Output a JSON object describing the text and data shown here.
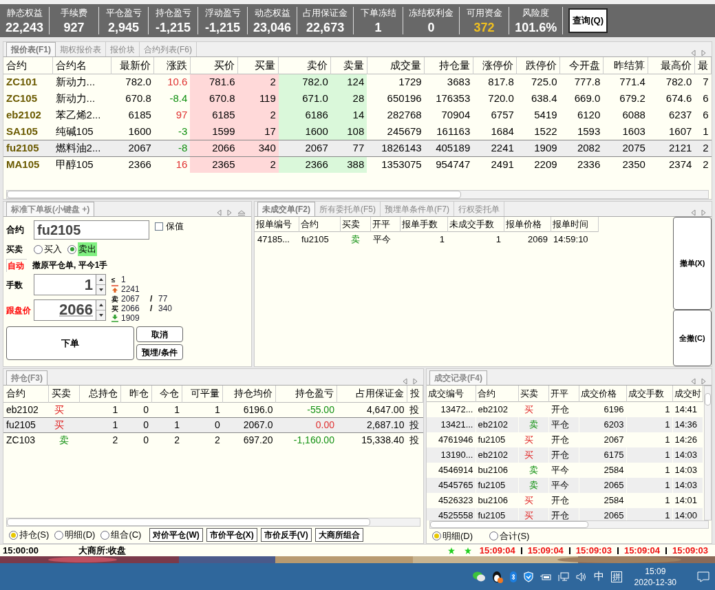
{
  "stats": [
    {
      "label": "静态权益",
      "value": "22,243",
      "highlight": false
    },
    {
      "label": "手续费",
      "value": "927",
      "highlight": false
    },
    {
      "label": "平仓盈亏",
      "value": "2,945",
      "highlight": false
    },
    {
      "label": "持仓盈亏",
      "value": "-1,215",
      "highlight": false
    },
    {
      "label": "浮动盈亏",
      "value": "-1,215",
      "highlight": false
    },
    {
      "label": "动态权益",
      "value": "23,046",
      "highlight": false
    },
    {
      "label": "占用保证金",
      "value": "22,673",
      "highlight": false
    },
    {
      "label": "下单冻结",
      "value": "1",
      "highlight": false
    },
    {
      "label": "冻结权利金",
      "value": "0",
      "highlight": false
    },
    {
      "label": "可用资金",
      "value": "372",
      "highlight": true
    },
    {
      "label": "风险度",
      "value": "101.6%",
      "highlight": false
    }
  ],
  "query_button": "查询(Q)",
  "quote_panel": {
    "tabs": [
      {
        "label": "报价表(F1)",
        "selected": true
      },
      {
        "label": "期权报价表",
        "selected": false
      },
      {
        "label": "报价块",
        "selected": false
      },
      {
        "label": "合约列表(F6)",
        "selected": false
      }
    ],
    "columns": [
      "合约",
      "合约名",
      "最新价",
      "涨跌",
      "买价",
      "买量",
      "卖价",
      "卖量",
      "成交量",
      "持仓量",
      "涨停价",
      "跌停价",
      "今开盘",
      "昨结算",
      "最高价",
      "最"
    ],
    "rows": [
      {
        "cells": [
          "ZC101",
          "新动力...",
          "782.0",
          "10.6",
          "781.6",
          "2",
          "782.0",
          "124",
          "1729",
          "3683",
          "817.8",
          "725.0",
          "777.8",
          "771.4",
          "782.0",
          "7"
        ],
        "rising": true,
        "selected": false
      },
      {
        "cells": [
          "ZC105",
          "新动力...",
          "670.8",
          "-8.4",
          "670.8",
          "119",
          "671.0",
          "28",
          "650196",
          "176353",
          "720.0",
          "638.4",
          "669.0",
          "679.2",
          "674.6",
          "6"
        ],
        "rising": false,
        "selected": false
      },
      {
        "cells": [
          "eb2102",
          "苯乙烯2...",
          "6185",
          "97",
          "6185",
          "2",
          "6186",
          "14",
          "282768",
          "70904",
          "6757",
          "5419",
          "6120",
          "6088",
          "6237",
          "6"
        ],
        "rising": true,
        "selected": false
      },
      {
        "cells": [
          "SA105",
          "纯碱105",
          "1600",
          "-3",
          "1599",
          "17",
          "1600",
          "108",
          "245679",
          "161163",
          "1684",
          "1522",
          "1593",
          "1603",
          "1607",
          "1"
        ],
        "rising": false,
        "selected": false
      },
      {
        "cells": [
          "fu2105",
          "燃料油2...",
          "2067",
          "-8",
          "2066",
          "340",
          "2067",
          "77",
          "1826143",
          "405189",
          "2241",
          "1909",
          "2082",
          "2075",
          "2121",
          "2"
        ],
        "rising": false,
        "selected": true
      },
      {
        "cells": [
          "MA105",
          "甲醇105",
          "2366",
          "16",
          "2365",
          "2",
          "2366",
          "388",
          "1353075",
          "954747",
          "2491",
          "2209",
          "2336",
          "2350",
          "2374",
          "2"
        ],
        "rising": true,
        "selected": false
      }
    ]
  },
  "order_panel": {
    "tab": "标准下单板(小键盘 +)",
    "contract_label": "合约",
    "contract_value": "fu2105",
    "hedge": {
      "label": "保值",
      "checked": false
    },
    "side_label": "买卖",
    "sides": [
      {
        "label": "买入",
        "selected": false
      },
      {
        "label": "卖出",
        "selected": true
      }
    ],
    "auto_label": "自动",
    "auto_message": "撤原平仓单, 平今1手",
    "lots_label": "手数",
    "lots_value": "1",
    "price_label": "跟盘价",
    "price_value": "2066",
    "info": [
      {
        "kind": "text",
        "mark": "≤",
        "value": "1"
      },
      {
        "kind": "limit_up",
        "value": "2241"
      },
      {
        "kind": "text",
        "mark": "卖",
        "value": "2067",
        "sep": "/",
        "volume": "77"
      },
      {
        "kind": "text",
        "mark": "买",
        "value": "2066",
        "sep": "/",
        "volume": "340"
      },
      {
        "kind": "limit_down",
        "value": "1909"
      }
    ],
    "submit": "下单",
    "cancel": "取消",
    "conditional": "预埋/条件"
  },
  "pending_panel": {
    "tabs": [
      {
        "label": "未成交单(F2)",
        "selected": true
      },
      {
        "label": "所有委托单(F5)",
        "selected": false
      },
      {
        "label": "预埋单条件单(F7)",
        "selected": false
      },
      {
        "label": "行权委托单",
        "selected": false
      }
    ],
    "columns": [
      "报单编号",
      "合约",
      "买卖",
      "开平",
      "报单手数",
      "未成交手数",
      "报单价格",
      "报单时间"
    ],
    "rows": [
      {
        "cells": [
          "47185...",
          "fu2105",
          "卖",
          "平今",
          "1",
          "1",
          "2069",
          "14:59:10"
        ],
        "buy": false
      }
    ],
    "buttons": [
      "撤单(X)",
      "全撤(C)"
    ]
  },
  "positions_panel": {
    "tab": "持仓(F3)",
    "columns": [
      "合约",
      "买卖",
      "总持仓",
      "昨仓",
      "今仓",
      "可平量",
      "持仓均价",
      "持仓盈亏",
      "占用保证金",
      "投"
    ],
    "rows": [
      {
        "cells": [
          "eb2102",
          "买",
          "1",
          "0",
          "1",
          "1",
          "6196.0",
          "-55.00",
          "4,647.00",
          "投"
        ],
        "buy": true,
        "pnl_rising": false,
        "selected": false
      },
      {
        "cells": [
          "fu2105",
          "买",
          "1",
          "0",
          "1",
          "0",
          "2067.0",
          "0.00",
          "2,687.10",
          "投"
        ],
        "buy": true,
        "pnl_rising": true,
        "selected": true
      },
      {
        "cells": [
          "ZC103",
          "卖",
          "2",
          "0",
          "2",
          "2",
          "697.20",
          "-1,160.00",
          "15,338.40",
          "投"
        ],
        "buy": false,
        "pnl_rising": false,
        "selected": false
      }
    ],
    "view_options": [
      {
        "label": "持仓(S)",
        "selected": true
      },
      {
        "label": "明细(D)",
        "selected": false
      },
      {
        "label": "组合(C)",
        "selected": false
      }
    ],
    "buttons": [
      "对价平仓(W)",
      "市价平仓(X)",
      "市价反手(V)",
      "大商所组合"
    ]
  },
  "trades_panel": {
    "tab": "成交记录(F4)",
    "columns": [
      "成交编号",
      "合约",
      "买卖",
      "开平",
      "成交价格",
      "成交手数",
      "成交时"
    ],
    "rows": [
      {
        "cells": [
          "13472...",
          "eb2102",
          "买",
          "开仓",
          "6196",
          "1",
          "14:41"
        ],
        "buy": true
      },
      {
        "cells": [
          "13421...",
          "eb2102",
          "卖",
          "平仓",
          "6203",
          "1",
          "14:36"
        ],
        "buy": false
      },
      {
        "cells": [
          "4761946",
          "fu2105",
          "买",
          "开仓",
          "2067",
          "1",
          "14:26"
        ],
        "buy": true
      },
      {
        "cells": [
          "13190...",
          "eb2102",
          "买",
          "开仓",
          "6175",
          "1",
          "14:03"
        ],
        "buy": true
      },
      {
        "cells": [
          "4546914",
          "bu2106",
          "卖",
          "平今",
          "2584",
          "1",
          "14:03"
        ],
        "buy": false
      },
      {
        "cells": [
          "4545765",
          "fu2105",
          "卖",
          "平今",
          "2065",
          "1",
          "14:03"
        ],
        "buy": false
      },
      {
        "cells": [
          "4526323",
          "bu2106",
          "买",
          "开仓",
          "2584",
          "1",
          "14:01"
        ],
        "buy": true
      },
      {
        "cells": [
          "4525558",
          "fu2105",
          "买",
          "开仓",
          "2065",
          "1",
          "14:00"
        ],
        "buy": true
      }
    ],
    "view_options": [
      {
        "label": "明细(D)",
        "selected": true
      },
      {
        "label": "合计(S)",
        "selected": false
      }
    ]
  },
  "status_bar": {
    "time": "15:00:00",
    "exchange_status": "大商所:收盘",
    "clocks": [
      "15:09:04",
      "15:09:04",
      "15:09:03",
      "15:09:04",
      "15:09:03"
    ]
  },
  "taskbar": {
    "ime": "中",
    "ime_mode": "拼",
    "time": "15:09",
    "date": "2020-12-30"
  }
}
